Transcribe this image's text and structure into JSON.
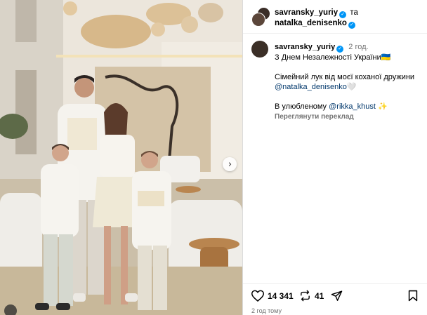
{
  "header": {
    "user1": "savransky_yuriy",
    "conjunction": "та",
    "user2": "natalka_denisenko"
  },
  "caption": {
    "username": "savransky_yuriy",
    "time": "2 год.",
    "line1": "З Днем Незалежності України🇺🇦",
    "line2_prefix": "Сімейний лук від моєї коханої дружини ",
    "line2_mention": "@natalka_denisenko",
    "line2_suffix": "🤍",
    "line3_prefix": "В улюбленому ",
    "line3_mention": "@rikka_khust",
    "line3_suffix": " ✨",
    "translate": "Переглянути переклад"
  },
  "actions": {
    "likes": "14 341",
    "reposts": "41"
  },
  "posted_ago": "2 год тому",
  "icons": [
    "heart-icon",
    "repost-icon",
    "share-icon",
    "bookmark-icon",
    "chevron-right-icon",
    "verified-icon"
  ],
  "colors": {
    "verified": "#0095f6",
    "mention": "#00376b",
    "muted": "#737373"
  }
}
